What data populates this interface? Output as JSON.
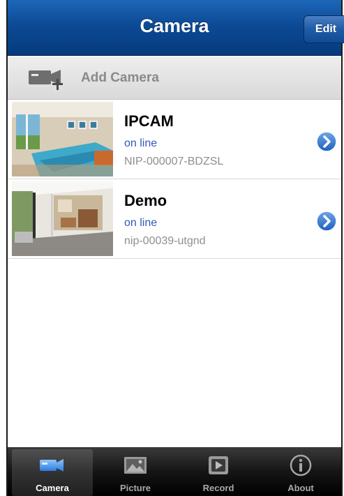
{
  "nav": {
    "title": "Camera",
    "edit_label": "Edit"
  },
  "add_camera": {
    "label": "Add Camera",
    "icon": "camera-plus-icon"
  },
  "cameras": [
    {
      "name": "IPCAM",
      "status": "on line",
      "id": "NIP-000007-BDZSL",
      "thumbnail": "bedroom-photo"
    },
    {
      "name": "Demo",
      "status": "on line",
      "id": "nip-00039-utgnd",
      "thumbnail": "patio-photo"
    }
  ],
  "tabs": [
    {
      "label": "Camera",
      "icon": "camera-icon",
      "selected": true
    },
    {
      "label": "Picture",
      "icon": "picture-icon",
      "selected": false
    },
    {
      "label": "Record",
      "icon": "record-icon",
      "selected": false
    },
    {
      "label": "About",
      "icon": "info-icon",
      "selected": false
    }
  ],
  "colors": {
    "nav_blue": "#0c4a95",
    "status_blue": "#2e5ab8",
    "disclosure_blue": "#2f73cf"
  }
}
